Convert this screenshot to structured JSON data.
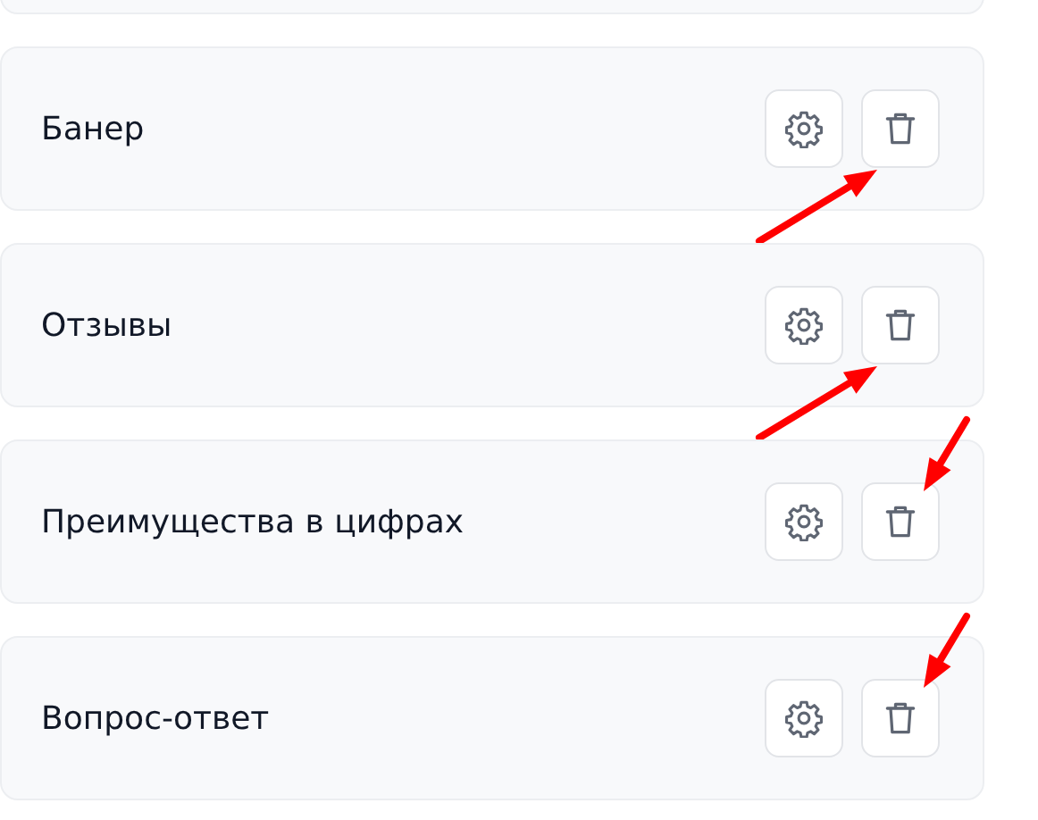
{
  "blocks": [
    {
      "title": "Банер",
      "arrow": {
        "kind": "lower-left"
      }
    },
    {
      "title": "Отзывы",
      "arrow": {
        "kind": "lower-left"
      }
    },
    {
      "title": "Преимущества в цифрах",
      "arrow": {
        "kind": "upper-right"
      }
    },
    {
      "title": "Вопрос-ответ",
      "arrow": {
        "kind": "upper-right"
      }
    }
  ]
}
